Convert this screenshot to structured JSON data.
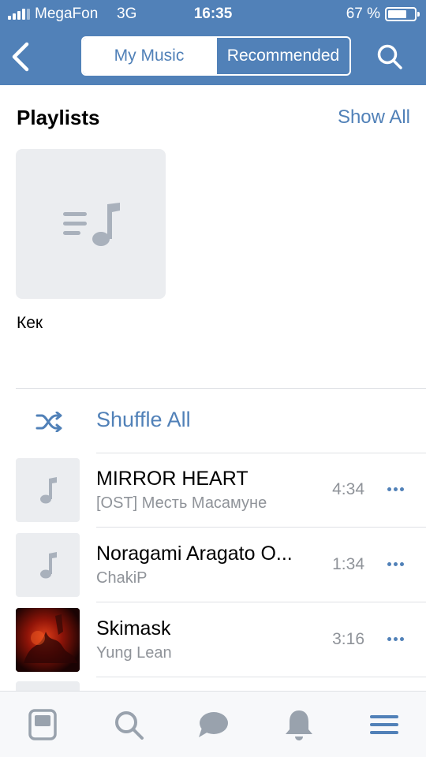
{
  "status_bar": {
    "carrier": "MegaFon",
    "network": "3G",
    "time": "16:35",
    "battery_percent": "67 %",
    "battery_level": 0.67
  },
  "header": {
    "back_icon": "chevron-left-icon",
    "tabs": [
      {
        "label": "My Music",
        "active": true
      },
      {
        "label": "Recommended",
        "active": false
      }
    ],
    "search_icon": "search-icon"
  },
  "playlists": {
    "title": "Playlists",
    "show_all_label": "Show All",
    "items": [
      {
        "name": "Кек",
        "icon": "playlist-icon"
      }
    ]
  },
  "shuffle": {
    "label": "Shuffle All",
    "icon": "shuffle-icon"
  },
  "tracks": [
    {
      "title": "MIRROR HEART",
      "artist": "[OST] Месть Масамуне",
      "duration": "4:34",
      "cover": "music-note-icon"
    },
    {
      "title": "Noragami Aragato O...",
      "artist": "ChakiP",
      "duration": "1:34",
      "cover": "music-note-icon"
    },
    {
      "title": "Skimask",
      "artist": "Yung Lean",
      "duration": "3:16",
      "cover": "album-art"
    }
  ],
  "tab_bar": {
    "items": [
      "news-icon",
      "search-icon",
      "messages-icon",
      "notifications-icon",
      "menu-icon"
    ]
  },
  "colors": {
    "accent": "#5181b8",
    "secondary_text": "#8f9399",
    "placeholder_bg": "#ebedf0",
    "icon_gray": "#a9b1bc"
  }
}
